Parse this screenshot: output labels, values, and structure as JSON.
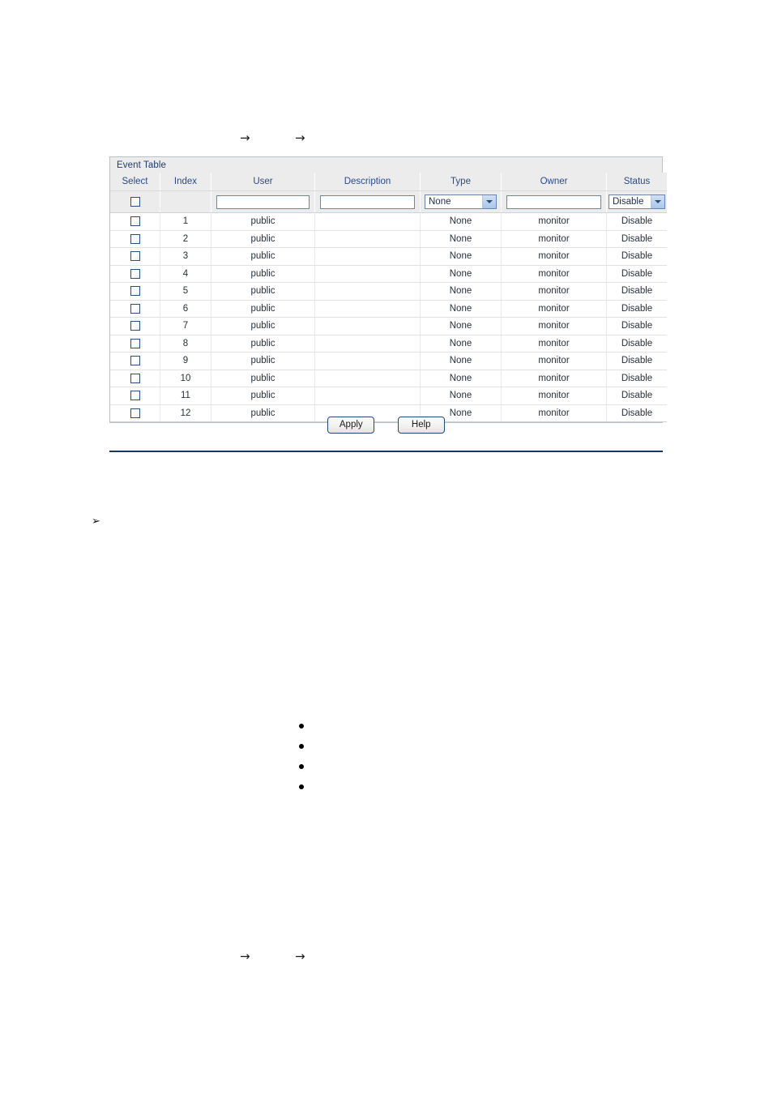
{
  "arrow_marks": {
    "glyph": "→",
    "top_row": [
      "→",
      "→"
    ],
    "bottom_row": [
      "→",
      "→"
    ]
  },
  "panel": {
    "title": "Event Table",
    "columns": [
      "Select",
      "Index",
      "User",
      "Description",
      "Type",
      "Owner",
      "Status"
    ],
    "entry_row": {
      "select_checkbox_checked": false,
      "index_value": "",
      "user_value": "",
      "user_placeholder": "",
      "description_value": "",
      "description_placeholder": "",
      "type_selected": "None",
      "type_options": [
        "None"
      ],
      "owner_value": "",
      "owner_placeholder": "",
      "status_selected": "Disable",
      "status_options": [
        "Disable"
      ]
    },
    "rows": [
      {
        "select": "",
        "index": "1",
        "user": "public",
        "description": "",
        "type": "None",
        "owner": "monitor",
        "status": "Disable"
      },
      {
        "select": "",
        "index": "2",
        "user": "public",
        "description": "",
        "type": "None",
        "owner": "monitor",
        "status": "Disable"
      },
      {
        "select": "",
        "index": "3",
        "user": "public",
        "description": "",
        "type": "None",
        "owner": "monitor",
        "status": "Disable"
      },
      {
        "select": "",
        "index": "4",
        "user": "public",
        "description": "",
        "type": "None",
        "owner": "monitor",
        "status": "Disable"
      },
      {
        "select": "",
        "index": "5",
        "user": "public",
        "description": "",
        "type": "None",
        "owner": "monitor",
        "status": "Disable"
      },
      {
        "select": "",
        "index": "6",
        "user": "public",
        "description": "",
        "type": "None",
        "owner": "monitor",
        "status": "Disable"
      },
      {
        "select": "",
        "index": "7",
        "user": "public",
        "description": "",
        "type": "None",
        "owner": "monitor",
        "status": "Disable"
      },
      {
        "select": "",
        "index": "8",
        "user": "public",
        "description": "",
        "type": "None",
        "owner": "monitor",
        "status": "Disable"
      },
      {
        "select": "",
        "index": "9",
        "user": "public",
        "description": "",
        "type": "None",
        "owner": "monitor",
        "status": "Disable"
      },
      {
        "select": "",
        "index": "10",
        "user": "public",
        "description": "",
        "type": "None",
        "owner": "monitor",
        "status": "Disable"
      },
      {
        "select": "",
        "index": "11",
        "user": "public",
        "description": "",
        "type": "None",
        "owner": "monitor",
        "status": "Disable"
      },
      {
        "select": "",
        "index": "12",
        "user": "public",
        "description": "",
        "type": "None",
        "owner": "monitor",
        "status": "Disable"
      }
    ]
  },
  "buttons": {
    "apply_label": "Apply",
    "help_label": "Help"
  },
  "marks": {
    "triangle_bullet": "➢",
    "list_bullets": [
      "•",
      "•",
      "•",
      "•"
    ]
  },
  "colors": {
    "header_text": "#2b4a8b",
    "title_text": "#1f3a6e",
    "panel_bg": "#ececec",
    "rule": "#1b3460",
    "control_border": "#6b86a8",
    "dropdown_button": "#a9c6ea"
  }
}
